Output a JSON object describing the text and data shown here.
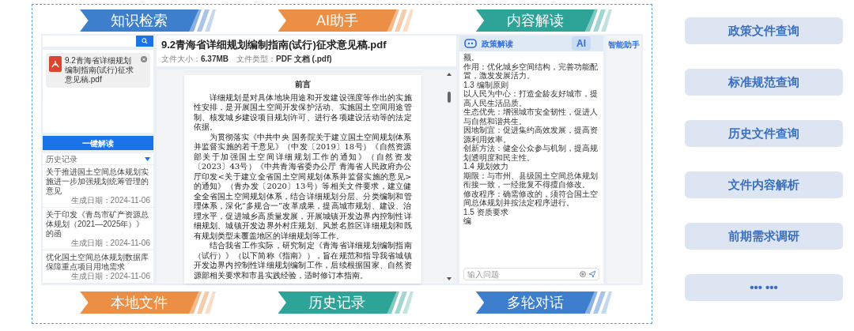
{
  "top_banners": [
    {
      "label": "知识检索",
      "color": "#3d7fcc"
    },
    {
      "label": "AI助手",
      "color": "#ec8e43"
    },
    {
      "label": "内容解读",
      "color": "#2ea398"
    }
  ],
  "app": {
    "left_panel": {
      "file": {
        "name": "9.2青海省详细规划编制指南(试行)征求意见稿.pdf"
      },
      "read_button": "一键解读",
      "history": {
        "title": "历史记录",
        "items": [
          {
            "title": "关于推进国土空间总体规划实施进一步加强规划统筹管理的意见",
            "date": "生成日期：2024-11-06"
          },
          {
            "title": "关于印发《青岛市矿产资源总体规划（2021—2025年）》的函",
            "date": "生成日期：2024-11-06"
          },
          {
            "title": "优化国土空间总体规划数据库保障重点项目用地需求",
            "date": "生成日期：2024-11-06"
          }
        ]
      }
    },
    "document": {
      "title": "9.2青海省详细规划编制指南(试行)征求意见稿.pdf",
      "meta": [
        {
          "label": "文件大小：",
          "value": "6.37MB"
        },
        {
          "label": "文件类型：",
          "value": "PDF 文档 (.pdf)"
        }
      ],
      "page_heading": "前言",
      "paragraphs": [
        "详细规划是对具体地块用途和开发建设强度等作出的实施性安排，是开展国土空间开发保护活动、实施国土空间用途管制、核发城乡建设项目规划许可、进行各项建设活动等的法定依据。",
        "为贯彻落实《中共中央 国务院关于建立国土空间规划体系并监督实施的若干意见》（中发〔2019〕18号）《自然资源部关于加强国土空间详细规划工作的通知》（自然资发〔2023〕43号）《中共青海省委办公厅 青海省人民政府办公厅印发<关于建立全省国土空间规划体系并监督实施的意见>的通知》（青办发〔2020〕13号）等相关文件要求，建立健全全省国土空间规划体系，结合详细规划分层、分类编制和管理体系，深化“多规合一”改革成果，提高城市规划、建设、治理水平，促进城乡高质量发展，开展城镇开发边界内控制性详细规划、城镇开发边界外村庄规划、风景名胜区详细规划和既有规划类型未覆盖地区的详细规划等工作。",
        "结合我省工作实际，研究制定《青海省详细规划编制指南（试行）》（以下简称《指南》），旨在规范和指导我省城镇开发边界内控制性详细规划编制工作，后续根据国家、自然资源部相关要求和市县实践经验，适时修订本指南。"
      ]
    },
    "chat": {
      "title": "政策解读",
      "badge": "AI",
      "lines": [
        "额。",
        "作用：优化城乡空间结构，完善功能配置，激发发展活力。",
        "1.3 编制原则",
        "以人民为中心：打造全龄友好城市，提高人民生活品质。",
        "生态优先：增强城市安全韧性，促进人与自然和谐共生。",
        "因地制宜：促进集约高效发展，提高资源利用效率。",
        "创新方法：健全公众参与机制，提高规划透明度和民主性。",
        "1.4 规划效力",
        "期限：与市州、县级国土空间总体规划衔接一致，一经批复不得擅自修改。",
        "修改程序：确需修改的，须符合国土空间总体规划并按法定程序进行。",
        "1.5 资质要求",
        "编"
      ],
      "input_placeholder": "输入问题"
    },
    "side_tab": "智能助手"
  },
  "bottom_banners": [
    {
      "label": "本地文件",
      "color": "#ec8e43"
    },
    {
      "label": "历史记录",
      "color": "#2ea398"
    },
    {
      "label": "多轮对话",
      "color": "#3d7fcc"
    }
  ],
  "features": [
    "政策文件查询",
    "标准规范查询",
    "历史文件查询",
    "文件内容解析",
    "前期需求调研",
    "••• •••"
  ]
}
